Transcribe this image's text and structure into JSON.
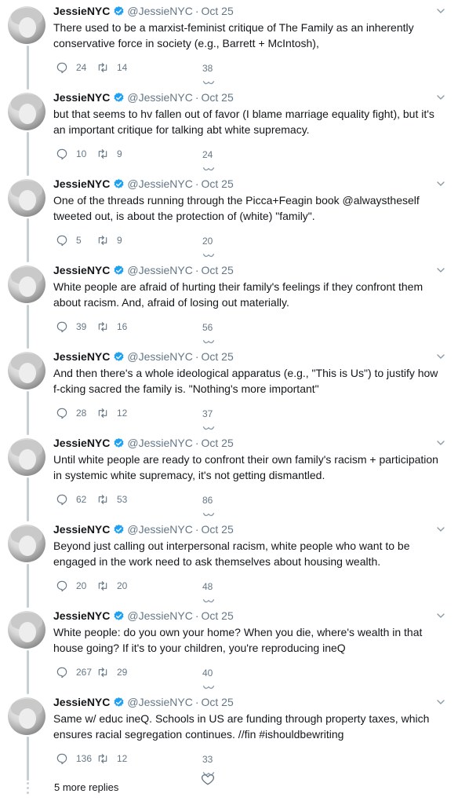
{
  "author": {
    "name": "JessieNYC",
    "handle": "@JessieNYC",
    "separator": "·",
    "date": "Oct 25"
  },
  "colors": {
    "verified": "#1da1f2",
    "muted": "#657786",
    "thread_line": "#c4cfd6",
    "text": "#14171a"
  },
  "icons": {
    "reply": "reply-icon",
    "retweet": "retweet-icon",
    "like": "like-icon",
    "verified": "verified-badge-icon",
    "menu": "chevron-down-icon"
  },
  "tweets": [
    {
      "text": "There used to be a marxist-feminist critique of The Family as an inherently conservative force in society (e.g., Barrett + McIntosh),",
      "replies": "24",
      "retweets": "14",
      "likes": "38"
    },
    {
      "text": "but that seems to hv fallen out of favor (I blame marriage equality fight), but it's an important critique for talking abt white supremacy.",
      "replies": "10",
      "retweets": "9",
      "likes": "24"
    },
    {
      "text": "One of the threads running through the Picca+Feagin book @alwaystheself tweeted out, is about the protection of (white) \"family\".",
      "replies": "5",
      "retweets": "9",
      "likes": "20"
    },
    {
      "text": "White people are afraid of hurting their family's feelings if they confront them about racism. And, afraid of losing out materially.",
      "replies": "39",
      "retweets": "16",
      "likes": "56"
    },
    {
      "text": "And then there's a whole ideological apparatus (e.g., \"This is Us\") to justify how f-cking sacred the family is. \"Nothing's more important\"",
      "replies": "28",
      "retweets": "12",
      "likes": "37"
    },
    {
      "text": "Until white people are ready to confront their own family's racism + participation in systemic white supremacy, it's not getting dismantled.",
      "replies": "62",
      "retweets": "53",
      "likes": "86"
    },
    {
      "text": "Beyond just calling out interpersonal racism, white people who want to be engaged in the work need to ask themselves about housing wealth.",
      "replies": "20",
      "retweets": "20",
      "likes": "48"
    },
    {
      "text": "White people: do you own your home? When you die, where's wealth in that house going? If it's to your children, you're reproducing ineQ",
      "replies": "267",
      "retweets": "29",
      "likes": "40"
    },
    {
      "text": "Same w/ educ ineQ. Schools in US are funding through property taxes, which ensures racial segregation continues.  //fin #ishouldbewriting",
      "replies": "136",
      "retweets": "12",
      "likes": "33"
    }
  ],
  "more_replies": "5 more replies"
}
